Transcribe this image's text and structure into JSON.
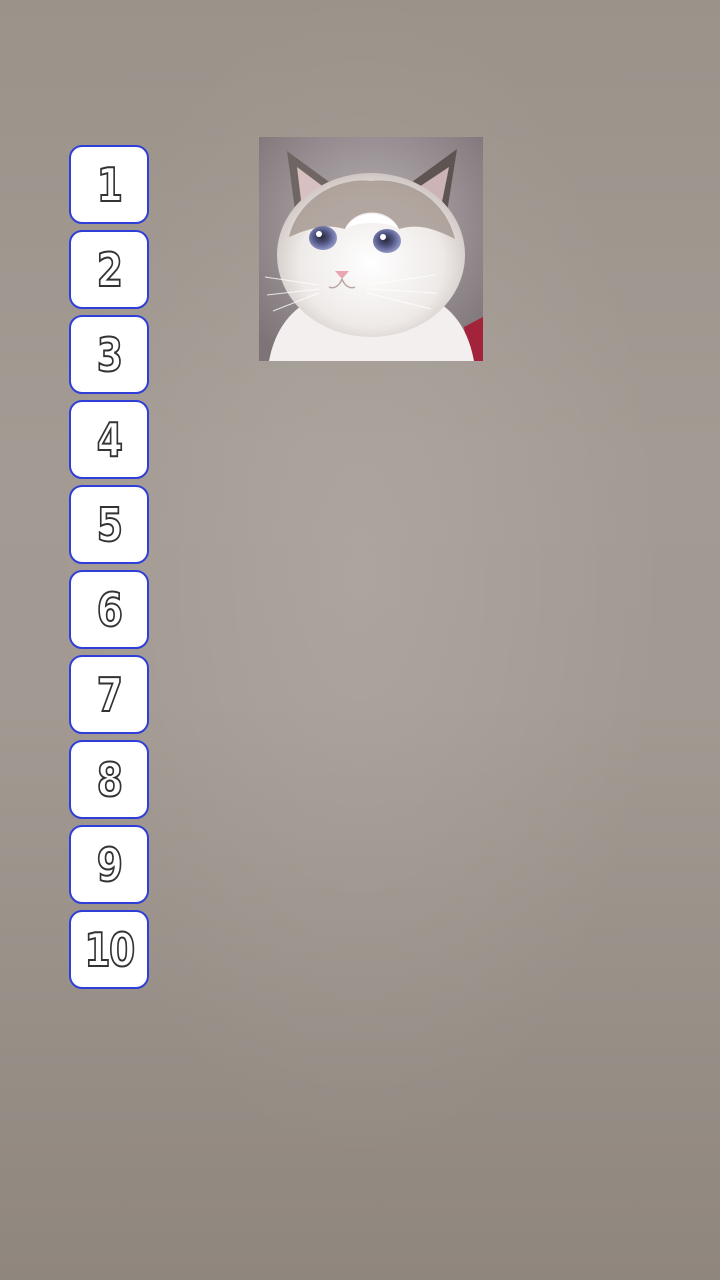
{
  "levels": {
    "items": [
      {
        "label": "1"
      },
      {
        "label": "2"
      },
      {
        "label": "3"
      },
      {
        "label": "4"
      },
      {
        "label": "5"
      },
      {
        "label": "6"
      },
      {
        "label": "7"
      },
      {
        "label": "8"
      },
      {
        "label": "9"
      },
      {
        "label": "10"
      }
    ]
  },
  "colors": {
    "button_border": "#2f3ed8",
    "button_fill": "#ffffff",
    "number_outline": "#333333",
    "background": "#a0988f"
  },
  "image": {
    "subject_icon": "cat-photo"
  }
}
